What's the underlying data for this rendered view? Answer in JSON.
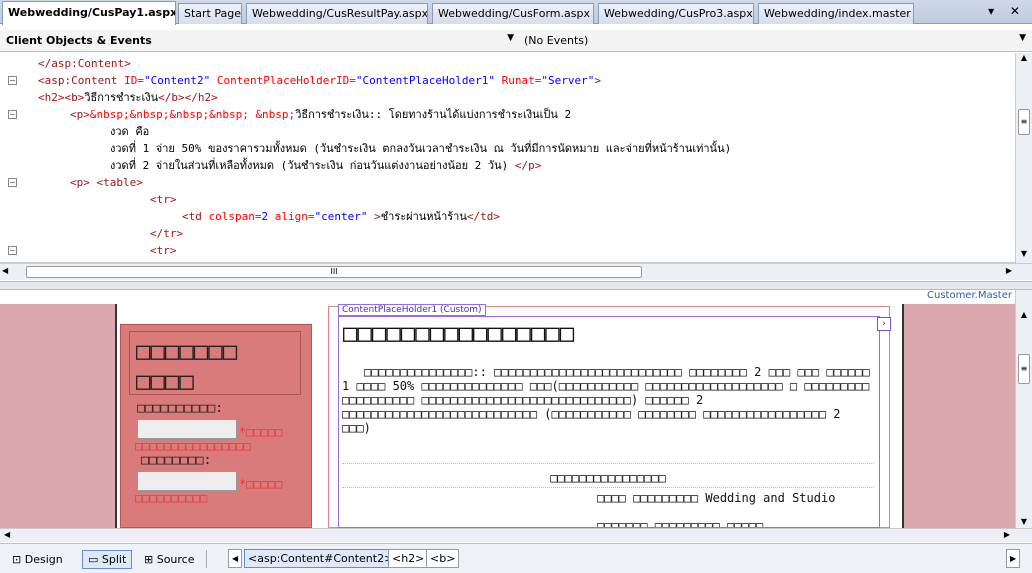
{
  "tabs": [
    {
      "label": "Webwedding/CusPay1.aspx",
      "active": true
    },
    {
      "label": "Start Page"
    },
    {
      "label": "Webwedding/CusResultPay.aspx"
    },
    {
      "label": "Webwedding/CusForm.aspx"
    },
    {
      "label": "Webwedding/CusPro3.aspx"
    },
    {
      "label": "Webwedding/index.master"
    }
  ],
  "tab_controls": "▾ ✕",
  "object_combo": "Client Objects & Events",
  "event_combo": "(No Events)",
  "code_lines": [
    [
      "</asp:Content>"
    ],
    [
      "<asp:Content",
      " ID=",
      "\"Content2\"",
      " ContentPlaceHolderID=",
      "\"ContentPlaceHolder1\"",
      " Runat=",
      "\"Server\"",
      ">"
    ],
    [
      "<h2><b>",
      "วิธีการชำระเงิน",
      "</b></h2>"
    ],
    [
      "<p>",
      "&nbsp;&nbsp;&nbsp;&nbsp; &nbsp;",
      "วิธีการชำระเงิน:: โดยทางร้านได้แบ่งการชำระเงินเป็น 2"
    ],
    [
      "งวด คือ"
    ],
    [
      "งวดที่ 1 จ่าย 50% ของราคารวมทั้งหมด (วันชำระเงิน ตกลงวันเวลาชำระเงิน ณ วันที่มีการนัดหมาย และจ่ายที่หน้าร้านเท่านั้น)"
    ],
    [
      "งวดที่ 2 จ่ายในส่วนที่เหลือทั้งหมด (วันชำระเงิน ก่อนวันแต่งงานอย่างน้อย 2 วัน) ",
      "</p>"
    ],
    [
      "<p> <table>"
    ],
    [
      "<tr>"
    ],
    [
      "<td",
      " colspan=",
      "2",
      " align=",
      "\"center\"",
      " >",
      "ชำระผ่านหน้าร้าน",
      "</td>"
    ],
    [
      "</tr>"
    ],
    [
      "<tr>"
    ]
  ],
  "hscroll_grip": "III",
  "master_label": "Customer.Master",
  "placeholder_label": "ContentPlaceHolder1 (Custom)",
  "design": {
    "heading": "□□□□□□□□□□□□□□□□",
    "para": "□□□□□□□□□□□□□□□:: □□□□□□□□□□□□□□□□□□□□□□□□□□ □□□□□□□□ 2 □□□ □□□ □□□□□□ 1 □□□□ 50% □□□□□□□□□□□□□□ □□□(□□□□□□□□□□□ □□□□□□□□□□□□□□□□□□□ □ □□□□□□□□□ □□□□□□□□□□ □□□□□□□□□□□□□□□□□□□□□□□□□□□□□) □□□□□□ 2 □□□□□□□□□□□□□□□□□□□□□□□□□□□ (□□□□□□□□□□□ □□□□□□□□ □□□□□□□□□□□□□□□□□ 2 □□□)",
    "table_heading": "□□□□□□□□□□□□□□□□",
    "table_cell": "□□□□ □□□□□□□□□ Wedding and Studio",
    "table_cell2": "□□□□□□□ □□□□□□□□□ □□□□□",
    "side_title": "□□□□□□□ □□□□",
    "side_label1": "□□□□□□□□□□:",
    "side_req1": "*□□□□□ □□□□□□□□□□□□□□□□",
    "side_label2": "□□□□□□□□:",
    "side_req2": "*□□□□□ □□□□□□□□□□",
    "side_button": ""
  },
  "status": {
    "design": "Design",
    "split": "Split",
    "source": "Source",
    "crumbs": [
      "<asp:Content#Content2>",
      "<h2>",
      "<b>"
    ]
  },
  "colors": {
    "accent": "#6a8cc7",
    "pink": "#dba8b0",
    "side": "#d97b7b",
    "red": "#e23c3c"
  }
}
